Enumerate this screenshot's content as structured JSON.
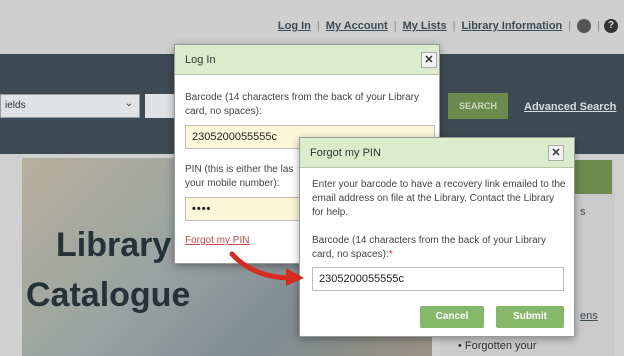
{
  "top_nav": {
    "links": [
      "Log In",
      "My Account",
      "My Lists",
      "Library Information"
    ],
    "separator": "|",
    "help_glyph": "?"
  },
  "search": {
    "field_select": "ields",
    "button": "SEARCH",
    "advanced": "Advanced Search"
  },
  "hero": {
    "line1": "Library",
    "line2": "Catalogue"
  },
  "right_panel": {
    "frag1": "s",
    "frag2": "ens",
    "bullet": "• Forgotten your"
  },
  "login_dialog": {
    "title": "Log In",
    "barcode_label": "Barcode (14 characters from the back of your Library card, no spaces):",
    "barcode_value": "2305200055555c",
    "pin_label_l1": "PIN (this is either the las",
    "pin_label_l2": "your mobile number):",
    "pin_value": "••••",
    "forgot_link": "Forgot my PIN",
    "close_glyph": "✕"
  },
  "forgot_dialog": {
    "title": "Forgot my PIN",
    "info": "Enter your barcode to have a recovery link emailed to the email address on file at the Library. Contact the Library for help.",
    "barcode_label": "Barcode (14 characters from the back of your Library card, no spaces):",
    "required_mark": "*",
    "barcode_value": "2305200055555c",
    "cancel": "Cancel",
    "submit": "Submit",
    "close_glyph": "✕"
  },
  "colors": {
    "dialog_header": "#dbeccc",
    "button_green": "#86b86a",
    "link_red": "#c24a4a",
    "arrow_red": "#d62b1e"
  },
  "icons": [
    "globe-icon",
    "help-icon",
    "close-icon",
    "chevron-down-icon",
    "red-arrow-annotation"
  ]
}
